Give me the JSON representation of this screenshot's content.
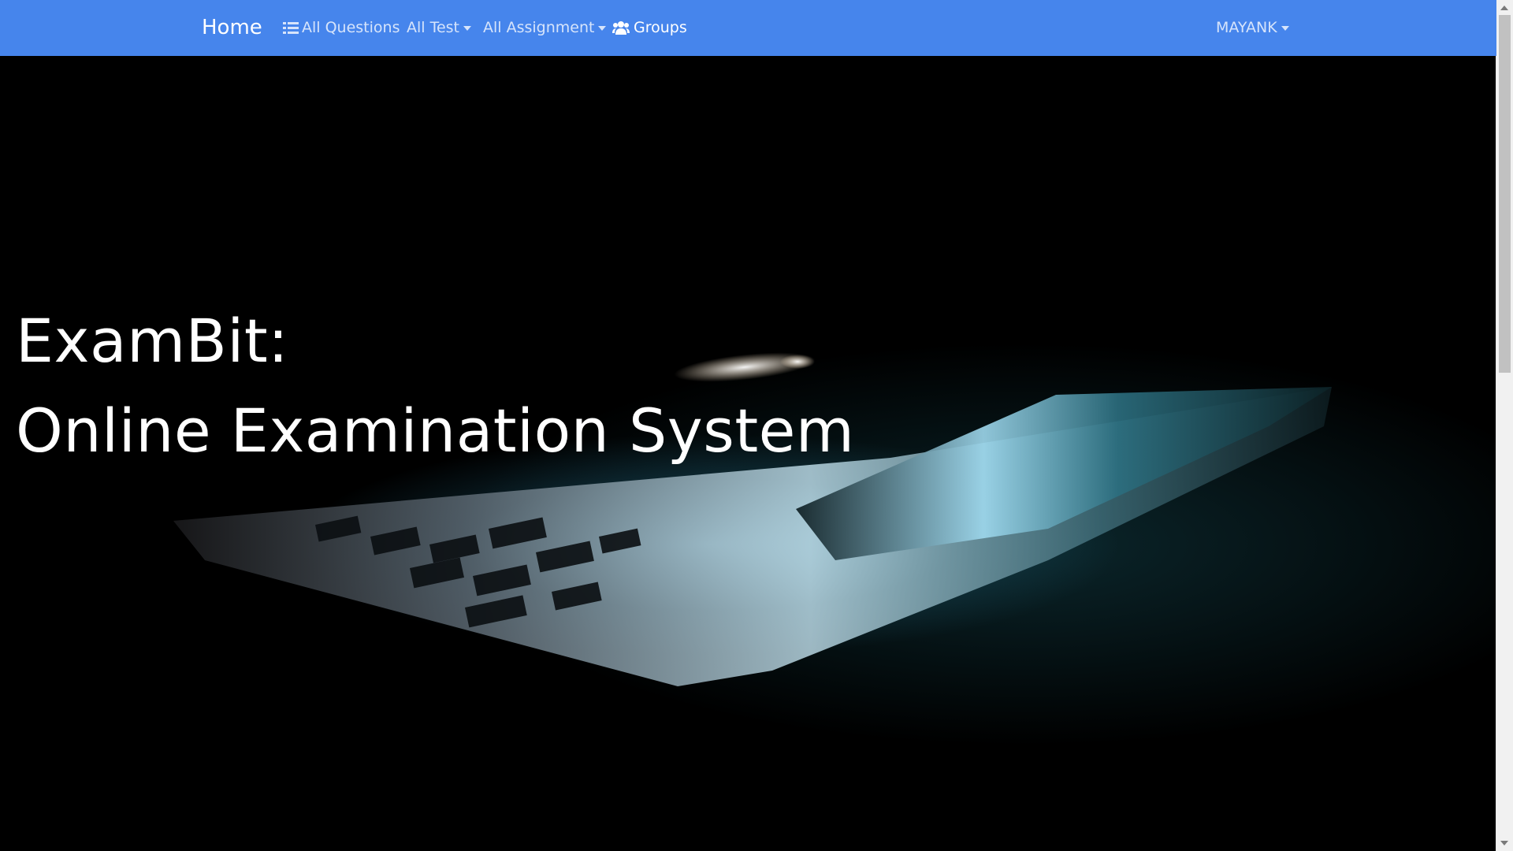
{
  "navbar": {
    "brand": "Home",
    "items": [
      {
        "label": "All Questions",
        "icon": "list-icon"
      },
      {
        "label": "All Test",
        "icon": "caret-down-icon"
      },
      {
        "label": "All Assignment",
        "icon": "caret-down-icon"
      },
      {
        "label": "Groups",
        "icon": "users-icon"
      }
    ],
    "user": "MAYANK",
    "color": "#4685ec"
  },
  "hero": {
    "line1": "ExamBit:",
    "line2": "Online Examination System"
  }
}
